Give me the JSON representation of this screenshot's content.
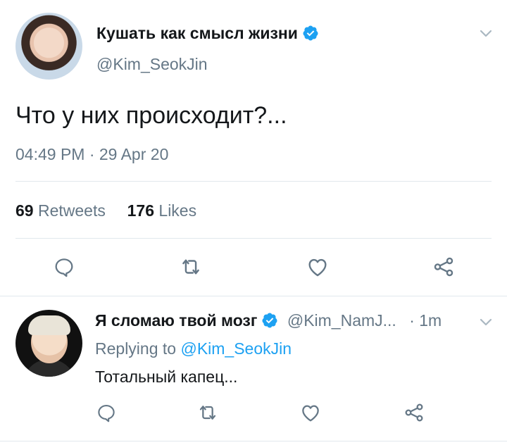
{
  "tweet": {
    "display_name": "Кушать как смысл жизни",
    "handle": "@Kim_SeokJin",
    "text": "Что у них происходит?...",
    "timestamp": "04:49 PM · 29 Apr 20",
    "retweets_count": "69",
    "retweets_label": "Retweets",
    "likes_count": "176",
    "likes_label": "Likes"
  },
  "reply": {
    "display_name": "Я сломаю твой мозг",
    "handle": "@Kim_NamJ...",
    "time": "· 1m",
    "replying_prefix": "Replying to",
    "replying_to": "@Kim_SeokJin",
    "text": "Тотальный капец..."
  },
  "colors": {
    "verified_blue": "#1da1f2",
    "secondary_text": "#657786",
    "icon_gray": "#657786",
    "divider": "#e1e8ed"
  },
  "icons": [
    "chevron-down-icon",
    "verified-icon",
    "reply-icon",
    "retweet-icon",
    "like-icon",
    "share-icon"
  ]
}
